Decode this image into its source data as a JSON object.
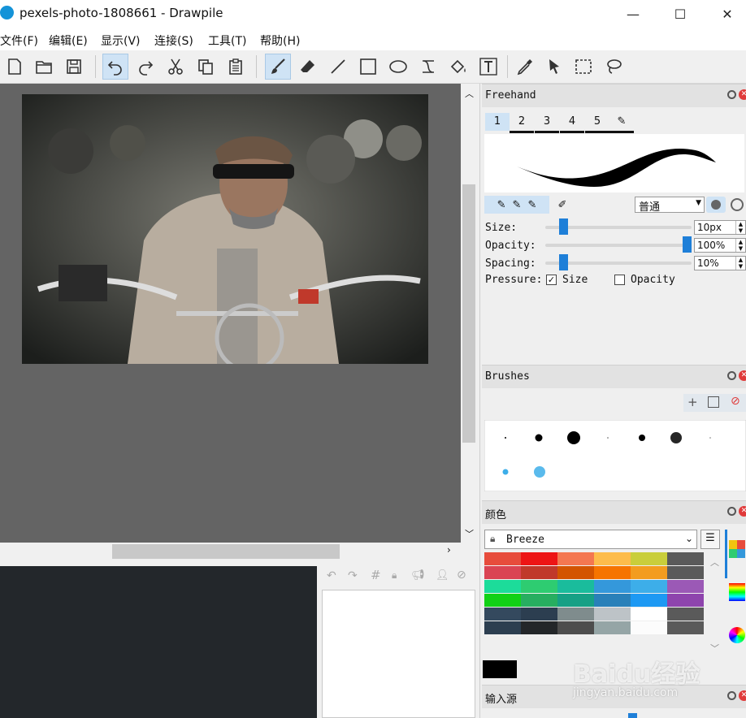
{
  "window": {
    "title": "pexels-photo-1808661 - Drawpile",
    "minimize": "—",
    "maximize": "☐",
    "close": "✕"
  },
  "menu": [
    "文件(F)",
    "编辑(E)",
    "显示(V)",
    "连接(S)",
    "工具(T)",
    "帮助(H)"
  ],
  "toolbar": {
    "icons": [
      "new-file-icon",
      "open-folder-icon",
      "save-icon",
      "undo-icon",
      "redo-icon",
      "cut-icon",
      "copy-icon",
      "paste-icon",
      "brush-icon",
      "eraser-icon",
      "line-icon",
      "rectangle-icon",
      "ellipse-icon",
      "bezier-icon",
      "fill-bucket-icon",
      "text-icon",
      "color-picker-icon",
      "laser-pointer-icon",
      "rect-select-icon",
      "lasso-select-icon"
    ],
    "active": [
      "undo-icon",
      "brush-icon"
    ]
  },
  "freehand": {
    "title": "Freehand",
    "preset_tabs": [
      "1",
      "2",
      "3",
      "4",
      "5"
    ],
    "blend_mode": "普通",
    "size_label": "Size:",
    "size_value": "10px",
    "size_level": 0.1,
    "opacity_label": "Opacity:",
    "opacity_value": "100%",
    "opacity_level": 1.0,
    "spacing_label": "Spacing:",
    "spacing_value": "10%",
    "spacing_level": 0.1,
    "pressure_label": "Pressure:",
    "pressure_size_label": "Size",
    "pressure_size_checked": true,
    "pressure_opacity_label": "Opacity",
    "pressure_opacity_checked": false
  },
  "brushes": {
    "title": "Brushes"
  },
  "colors": {
    "title": "颜色",
    "palette_name": "Breeze",
    "current_color": "#000000",
    "swatches": [
      [
        "#e74c3c",
        "#ed1515",
        "#f47750",
        "#fdbc4b",
        "#c9ce3b",
        "#5a5a5a"
      ],
      [
        "#da4453",
        "#c0392b",
        "#d35400",
        "#f67400",
        "#f39c1f",
        "#5a5a5a"
      ],
      [
        "#1cdc9a",
        "#2ecc71",
        "#1abc9c",
        "#3498db",
        "#3daee9",
        "#9b59b6"
      ],
      [
        "#11d116",
        "#27ae60",
        "#16a085",
        "#2980b9",
        "#1d99f3",
        "#8e44ad"
      ],
      [
        "#34495e",
        "#2c3e50",
        "#7f8c8d",
        "#bdc3c7",
        "#ffffff",
        "#5a5a5a"
      ],
      [
        "#2c3e50",
        "#232629",
        "#4d4d4d",
        "#95a5a6",
        "#fcfcfc",
        "#5a5a5a"
      ]
    ]
  },
  "input": {
    "title": "输入源"
  },
  "watermark": {
    "text": "Baidu经验",
    "sub": "jingyan.baidu.com"
  }
}
